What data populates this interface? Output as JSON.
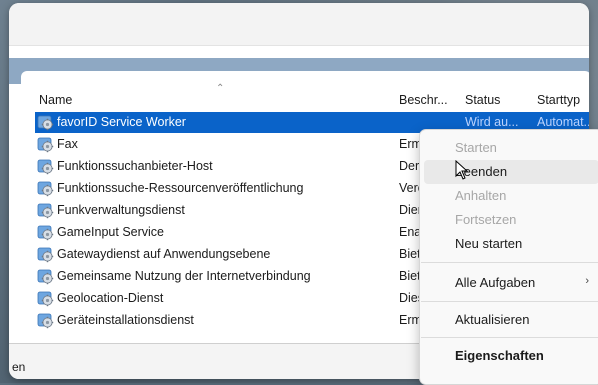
{
  "columns": {
    "name": "Name",
    "description": "Beschr...",
    "status": "Status",
    "startup_type": "Starttyp"
  },
  "services": [
    {
      "name": "favorID Service Worker",
      "desc": "",
      "status": "Wird au...",
      "start": "Automat...",
      "selected": true
    },
    {
      "name": "Fax",
      "desc": "Erm",
      "status": "",
      "start": ""
    },
    {
      "name": "Funktionssuchanbieter-Host",
      "desc": "Der",
      "status": "",
      "start": ""
    },
    {
      "name": "Funktionssuche-Ressourcenveröffentlichung",
      "desc": "Verö",
      "status": "",
      "start": ""
    },
    {
      "name": "Funkverwaltungsdienst",
      "desc": "Dier",
      "status": "",
      "start": ""
    },
    {
      "name": "GameInput Service",
      "desc": "Ena",
      "status": "",
      "start": ""
    },
    {
      "name": "Gatewaydienst auf Anwendungsebene",
      "desc": "Biet",
      "status": "",
      "start": ""
    },
    {
      "name": "Gemeinsame Nutzung der Internetverbindung",
      "desc": "Biet",
      "status": "",
      "start": ""
    },
    {
      "name": "Geolocation-Dienst",
      "desc": "Dies",
      "status": "",
      "start": ""
    },
    {
      "name": "Geräteinstallationsdienst",
      "desc": "Erm",
      "status": "",
      "start": ""
    }
  ],
  "context_menu": {
    "start": "Starten",
    "stop": "Beenden",
    "pause": "Anhalten",
    "resume": "Fortsetzen",
    "restart": "Neu starten",
    "all_tasks": "Alle Aufgaben",
    "refresh": "Aktualisieren",
    "properties": "Eigenschaften"
  },
  "status_bar": {
    "text": "en"
  },
  "icons": {
    "service": "gear-icon",
    "submenu": "chevron-right-icon",
    "sort": "chevron-up-icon",
    "cursor": "mouse-pointer-icon"
  },
  "colors": {
    "selection": "#0a63c9",
    "band": "#8ea8c3"
  }
}
